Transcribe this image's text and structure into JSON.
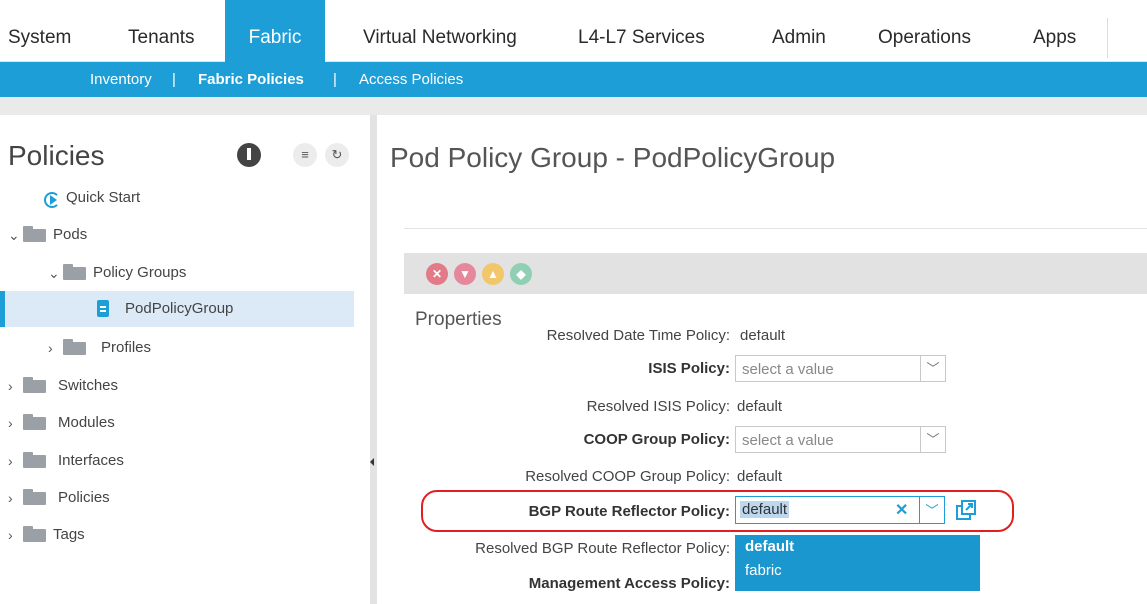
{
  "topnav": {
    "tabs": [
      {
        "label": "System",
        "active": false
      },
      {
        "label": "Tenants",
        "active": false
      },
      {
        "label": "Fabric",
        "active": true
      },
      {
        "label": "Virtual Networking",
        "active": false
      },
      {
        "label": "L4-L7 Services",
        "active": false
      },
      {
        "label": "Admin",
        "active": false
      },
      {
        "label": "Operations",
        "active": false
      },
      {
        "label": "Apps",
        "active": false
      }
    ]
  },
  "subnav": {
    "items": [
      {
        "label": "Inventory",
        "active": false
      },
      {
        "label": "|",
        "active": false
      },
      {
        "label": "Fabric Policies",
        "active": true
      },
      {
        "label": "|",
        "active": false
      },
      {
        "label": "Access Policies",
        "active": false
      }
    ]
  },
  "sidebar": {
    "title": "Policies",
    "tree": [
      {
        "label": "Quick Start"
      },
      {
        "label": "Pods",
        "expanded": true
      },
      {
        "label": "Policy Groups",
        "expanded": true
      },
      {
        "label": "PodPolicyGroup",
        "selected": true
      },
      {
        "label": "Profiles"
      },
      {
        "label": "Switches"
      },
      {
        "label": "Modules"
      },
      {
        "label": "Interfaces"
      },
      {
        "label": "Policies"
      },
      {
        "label": "Tags"
      }
    ]
  },
  "main": {
    "title": "Pod Policy Group - PodPolicyGroup",
    "properties_label": "Properties",
    "fault_icons": [
      "critical-fault-icon",
      "major-fault-icon",
      "minor-fault-icon",
      "warning-fault-icon"
    ],
    "rows": {
      "resolved_datetime_label": "Resolved Date Time Policy:",
      "resolved_datetime_value": "default",
      "isis_label": "ISIS Policy:",
      "isis_placeholder": "select a value",
      "resolved_isis_label": "Resolved ISIS Policy:",
      "resolved_isis_value": "default",
      "coop_label": "COOP Group Policy:",
      "coop_placeholder": "select a value",
      "resolved_coop_label": "Resolved COOP Group Policy:",
      "resolved_coop_value": "default",
      "bgp_label": "BGP Route Reflector Policy:",
      "bgp_value": "default",
      "resolved_bgp_label": "Resolved BGP Route Reflector Policy:",
      "mgmt_label": "Management Access Policy:"
    },
    "dropdown_options": [
      "default",
      "fabric"
    ]
  },
  "colors": {
    "accent": "#1e9ed6",
    "highlight_ring": "#e02020",
    "dropdown_bg": "#1b97cf"
  }
}
